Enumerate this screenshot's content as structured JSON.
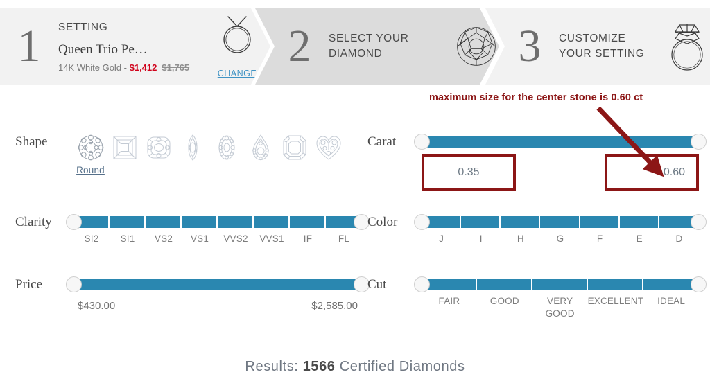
{
  "steps": [
    {
      "number": "1",
      "title": "SETTING",
      "setting_name": "Queen Trio Pe…",
      "metal": "14K White Gold - ",
      "price_now": "$1,412",
      "price_was": "$1,765",
      "change_label": "CHANGE",
      "icon": "ring-icon",
      "active": false
    },
    {
      "number": "2",
      "title_line1": "SELECT YOUR",
      "title_line2": "DIAMOND",
      "icon": "round-diamond-icon",
      "active": true
    },
    {
      "number": "3",
      "title_line1": "CUSTOMIZE",
      "title_line2": "YOUR SETTING",
      "icon": "ring-with-diamond-icon",
      "active": false
    }
  ],
  "filters": {
    "shape": {
      "label": "Shape",
      "selected": "Round",
      "options": [
        {
          "name": "Round",
          "icon": "round-shape-icon",
          "selected": true
        },
        {
          "name": "Princess",
          "icon": "princess-shape-icon",
          "selected": false
        },
        {
          "name": "Cushion",
          "icon": "cushion-shape-icon",
          "selected": false
        },
        {
          "name": "Marquise",
          "icon": "marquise-shape-icon",
          "selected": false
        },
        {
          "name": "Oval",
          "icon": "oval-shape-icon",
          "selected": false
        },
        {
          "name": "Pear",
          "icon": "pear-shape-icon",
          "selected": false
        },
        {
          "name": "Emerald",
          "icon": "emerald-shape-icon",
          "selected": false
        },
        {
          "name": "Heart",
          "icon": "heart-shape-icon",
          "selected": false
        }
      ]
    },
    "carat": {
      "label": "Carat",
      "min_value": "0.35",
      "max_value": "0.60"
    },
    "clarity": {
      "label": "Clarity",
      "ticks": [
        "SI2",
        "SI1",
        "VS2",
        "VS1",
        "VVS2",
        "VVS1",
        "IF",
        "FL"
      ]
    },
    "color": {
      "label": "Color",
      "ticks": [
        "J",
        "I",
        "H",
        "G",
        "F",
        "E",
        "D"
      ]
    },
    "price": {
      "label": "Price",
      "min_value": "$430.00",
      "max_value": "$2,585.00"
    },
    "cut": {
      "label": "Cut",
      "ticks": [
        "FAIR",
        "GOOD",
        "VERY GOOD",
        "EXCELLENT",
        "IDEAL"
      ]
    }
  },
  "annotation": {
    "text": "maximum size for the center stone is 0.60 ct",
    "color": "#8c1616"
  },
  "results": {
    "prefix": "Results: ",
    "count": "1566",
    "suffix": " Certified Diamonds"
  },
  "colors": {
    "track": "#2a87b0",
    "annotation_red": "#8c1616",
    "sale_price_red": "#d0021b",
    "link_blue": "#3f93c4"
  }
}
